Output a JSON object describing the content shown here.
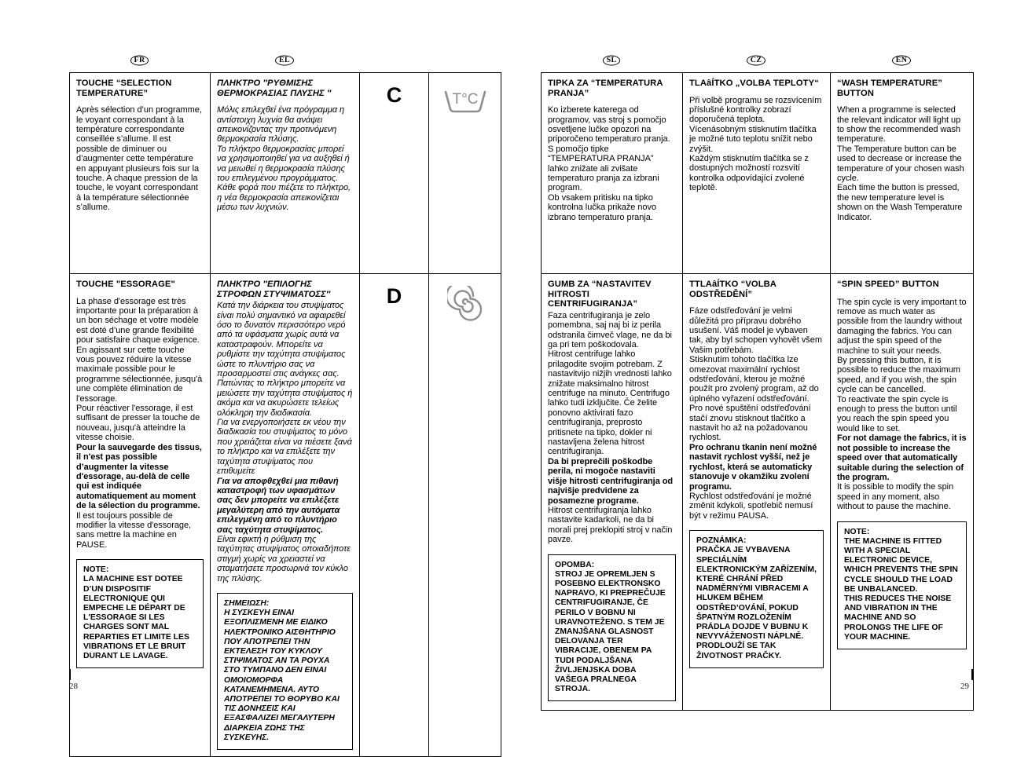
{
  "document": {
    "page_numbers": {
      "left": "28",
      "right": "29"
    }
  },
  "language_badges": {
    "fr": "FR",
    "el": "EL",
    "sl": "SL",
    "cz": "CZ",
    "en": "EN"
  },
  "markers": {
    "c": {
      "letter": "C",
      "icon": "wash-temperature-tub-icon",
      "icon_label": "T°C"
    },
    "d": {
      "letter": "D",
      "icon": "spin-spiral-icon"
    }
  },
  "section_c": {
    "fr": {
      "title": "TOUCHE  “SELECTION TEMPERATURE”",
      "paragraphs": [
        "Après sélection d’un programme, le voyant correspondant à la température correspondante conseillée s’allume. Il est possible de diminuer ou d’augmenter cette température en appuyant plusieurs fois sur la touche. A chaque pression de la touche, le voyant correspondant à la température sélectionnée s’allume."
      ]
    },
    "el": {
      "title": "ΠΛΗΚΤΡΟ ″ΡΥΘΜΙΣΗΣ ΘΕΡΜΟΚΡΑΣΙΑΣ ΠΛΥΣΗΣ ″",
      "paragraphs": [
        "Μόλις επιλεχθεί ένα πρόγραμμα η αντίστοιχη λυχνία θα ανάψει απεικονίζοντας την προτινόμενη θερμοκρασία πλύσης.",
        "Το πλήκτρο θερμοκρασίας μπορεί να χρησιμοποιηθεί για να αυξηθεί ή να μειωθεί η θερμοκρασία πλύσης του επιλεγμένου προγράμματος.",
        "Κάθε φορά που πιέζετε το πλήκτρο, η νέα θερμοκρασία απεικονίζεται μέσω των λυχνιών."
      ]
    },
    "sl": {
      "title": "TIPKA ZA “TEMPERATURA PRANJA”",
      "paragraphs": [
        "Ko izberete katerega od programov, vas stroj s pomočjo osvetljene lučke opozori na priporočeno temperaturo pranja.",
        "S pomočjo tipke “TEMPERATURA PRANJA” lahko znižate ali zvišate temperaturo pranja za izbrani program.",
        "Ob vsakem pritisku na tipko kontrolna lučka prikaže novo izbrano temperaturo pranja."
      ]
    },
    "cz": {
      "title": "TLAâÍTKO „VOLBA TEPLOTY“",
      "paragraphs": [
        "Při volbě programu se rozsvícením příslušné kontrolky zobrazí doporučená teplota.",
        "Vícenásobným stisknutím tlačítka je možné tuto teplotu snížit nebo zvýšit.",
        "Každým stisknutím tlačítka se z dostupných možností rozsvítí kontrolka odpovídající zvolené teplotě."
      ]
    },
    "en": {
      "title": "“WASH TEMPERATURE” BUTTON",
      "paragraphs": [
        "When a programme is selected the relevant indicator will light up to show the recommended wash temperature.",
        "The Temperature button can be used to decrease or increase the temperature of your chosen wash cycle.",
        "Each time the button is pressed, the new temperature level is shown on the Wash Temperature Indicator."
      ]
    }
  },
  "section_d": {
    "fr": {
      "title": "TOUCHE \"ESSORAGE\"",
      "paragraphs": [
        "La phase d'essorage est très importante pour la préparation à un bon séchage et votre modèle est doté d’une grande flexibilité pour satisfaire chaque exigence.",
        "En agissant sur cette touche vous pouvez réduire la vitesse maximale possible pour le programme sélectionnée, jusqu'à une complète élimination de l'essorage.",
        "Pour réactiver l'essorage, il est suffisant de presser la touche de nouveau, jusqu'à atteindre la vitesse choisie."
      ],
      "bold_paragraph": "Pour la sauvegarde des tissus, il n'est pas possible d’augmenter la vitesse d'essorage, au-delà de celle qui est indiquée automatiquement au moment de la sélection du programme.",
      "tail_paragraph": "Il est toujours possible de modifier la vitesse d'essorage, sans mettre la machine en PAUSE.",
      "note": "NOTE:\nLA MACHINE EST DOTEE D’UN DISPOSITIF ELECTRONIQUE QUI EMPECHE LE DÉPART DE L'ESSORAGE SI LES CHARGES SONT MAL REPARTIES ET LIMITE LES VIBRATIONS ET LE BRUIT DURANT LE LAVAGE."
    },
    "el": {
      "title": "ΠΛΗΚΤΡΟ ″ΕΠΙΛΟΓΗΣ ΣΤΡΟΦΩΝ ΣΤΥΨΙΜΑΤΟΣΣ″",
      "paragraphs": [
        "Κατά την διάρκεια του στυψίματος είναι πολύ σημαντικό να αφαιρεθεί όσο το δυνατόν περισσότερο νερό από τα υφάσματα χωρίς αυτά να καταστραφούν. Μπορείτε να ρυθμίστε την ταχύτητα στυψίματος ώστε το πλυντήριο σας να προσαρμοστεί στις ανάγκες σας.",
        "Πατώντας το πλήκτρο μπορείτε να μειώσετε την ταχύτητα στυψίματος ή ακόμα και να ακυρώσετε τελείως ολόκληρη την διαδικασία.",
        "Για να ενεργοποιήσετε εκ νέου την διαδικασία του στυψίματος το μόνο που χρειάζεται είναι να πιέσετε ξανά το πλήκτρο και να επιλέξετε την ταχύτητα στυψίματος που επιθυμείτε"
      ],
      "bold_paragraph": "Για να αποφθεχθεί μια πιθανή καταστροφή των υφασμάτων σας δεν μπορείτε να επιλέξετε μεγαλύτερη από την αυτόματα επιλεγμένη από το πλυντήριο σας ταχύτητα στυψίματος.",
      "tail_paragraph": "Είναι εφικτή η ρύθμιση της ταχύτητας στυψίματος οποιαδήποτε στιγμή χωρίς να χρειαστεί να σταματήσετε προσωρινά τον κύκλο της πλύσης.",
      "note": "ΣΗΜΕΙΩΣΗ:\nΗ ΣΥΣΚΕΥΗ ΕΙΝΑΙ ΕΞΟΠΛΙΣΜΕΝΗ ΜΕ ΕΙΔΙΚΟ ΗΛΕΚΤΡΟΝΙΚΟ ΑΙΣΘΗΤΗΡΙΟ ΠΟΥ ΑΠΟΤΡΕΠΕΙ ΤΗΝ ΕΚΤΕΛΕΣΗ ΤΟΥ ΚΥΚΛΟΥ ΣΤΙΨΙΜΑΤΟΣ ΑΝ ΤΑ ΡΟΥΧΑ ΣΤΟ ΤΥΜΠΑΝΟ ΔΕΝ ΕΙΝΑΙ ΟΜΟΙΟΜΟΡΦΑ ΚΑΤΑΝΕΜΗΜΕΝΑ. ΑΥΤΟ ΑΠΟΤΡΕΠΕΙ ΤΟ ΘΟΡΥΒΟ ΚΑΙ ΤΙΣ ΔΟΝΗΣΕΙΣ ΚΑΙ ΕΞΑΣΦΑΛΙΖΕΙ ΜΕΓΑΛΥΤΕΡΗ ΔΙΑΡΚΕΙΑ ΖΩΗΣ ΤΗΣ ΣΥΣΚΕΥΗΣ."
    },
    "sl": {
      "title": "GUMB ZA “NASTAVITEV HITROSTI CENTRIFUGIRANJA”",
      "paragraphs": [
        "Faza centrifugiranja je zelo pomembna, saj naj bi iz perila odstranila čimveč vlage, ne da bi ga pri tem poškodovala.",
        "Hitrost centrifuge lahko prilagodite svojim potrebam. Z nastavitvijo nižjih vrednosti lahko znižate maksimalno hitrost centrifuge na minuto. Centrifugo lahko tudi izključite. Če želite ponovno aktivirati fazo centrifugiranja, preprosto pritisnete na tipko, dokler ni nastavljena želena hitrost centrifugiranja."
      ],
      "bold_paragraph": "Da bi preprečili poškodbe perila, ni mogoče nastaviti višje hitrosti centrifugiranja od najvišje predvidene za posamezne programe.",
      "tail_paragraph": "Hitrost centrifugiranja lahko nastavite kadarkoli, ne da bi morali prej preklopiti stroj v način pavze.",
      "note": "OPOMBA:\nSTROJ JE OPREMLJEN S POSEBNO ELEKTRONSKO NAPRAVO, KI PREPREČUJE CENTRIFUGIRANJE, ČE PERILO V BOBNU NI URAVNOTEŽENO. S TEM JE ZMANJŠANA GLASNOST DELOVANJA TER VIBRACIJE, OBENEM PA TUDI PODALJŠANA ŽIVLJENJSKA DOBA VAŠEGA PRALNEGA STROJA."
    },
    "cz": {
      "title": "TTLAâÍTKO “VOLBA ODSTŘEDĚNÍ”",
      "paragraphs": [
        "Fáze odstřeďování je velmi důležitá pro přípravu dobrého usušení. Váš model je vybaven tak, aby byl schopen vyhovět všem Vašim potřebám.",
        "Stisknutím tohoto tlačítka lze omezovat maximální rychlost odstřeďování, kterou je možné použít pro zvolený program, až do úplného vyřazení odstřeďování.",
        "Pro nové spuštění odstřeďování stačí znovu stisknout tlačítko a nastavit ho až na požadovanou rychlost."
      ],
      "bold_paragraph": "Pro ochranu tkanin není možné nastavit rychlost vyšší, než je rychlost, která se automaticky stanovuje v okamžiku zvolení programu.",
      "tail_paragraph": "Rychlost odstřeďování je možné změnit kdykoli, spotřebič nemusí být v režimu PAUSA.",
      "note": "POZNÁMKA:\nPRAČKA JE VYBAVENA SPECIÁLNÍM ELEKTRONICKÝM ZAŘÍZENÍM, KTERÉ CHRÁNÍ PŘED NADMĚRNÝMI VIBRACEMI A HLUKEM BĚHEM ODSTŘED’OVÁNÍ, POKUD ŠPATNÝM ROZLOŽENÍM PRÁDLA DOJDE V BUBNU K NEVYVÁŽENOSTI NÁPLNĚ. PRODLOUŽÍ SE TAK ŽIVOTNOST PRAČKY."
    },
    "en": {
      "title": "“SPIN SPEED” BUTTON",
      "paragraphs": [
        "The spin cycle is very important to remove as much water as possible from the laundry without damaging the fabrics. You can adjust the spin speed of the machine to suit your needs.",
        "By pressing this button, it is possible to reduce the maximum speed, and if you wish, the spin cycle can be cancelled.",
        "To reactivate the spin cycle is enough to press the button until you reach the spin speed you would like to set."
      ],
      "bold_paragraph": "For not damage the fabrics, it is not possible to increase the speed over that automatically suitable during the selection of the program.",
      "tail_paragraph": "It is possible to modify the spin speed in any moment, also without to pause the machine.",
      "note": "NOTE:\nTHE MACHINE IS FITTED WITH A SPECIAL ELECTRONIC DEVICE, WHICH PREVENTS THE SPIN CYCLE SHOULD THE LOAD BE UNBALANCED.\nTHIS REDUCES THE NOISE AND VIBRATION IN THE MACHINE AND SO PROLONGS THE LIFE OF YOUR MACHINE."
    }
  }
}
